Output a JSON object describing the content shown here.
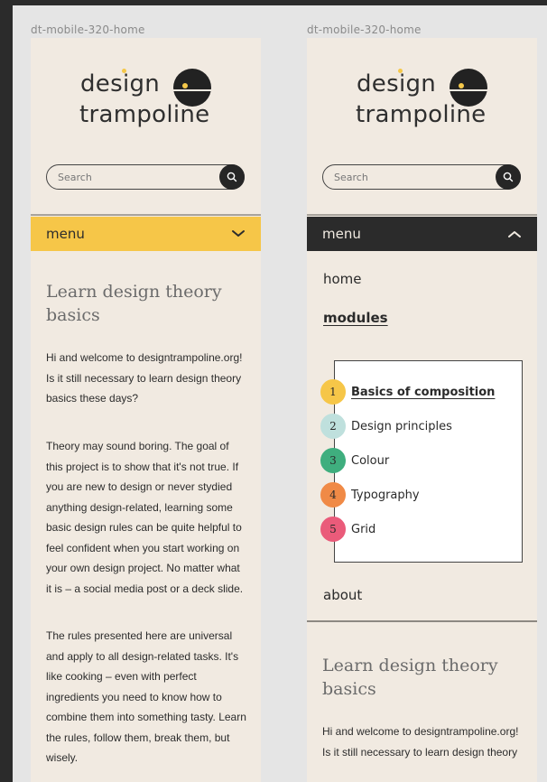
{
  "frames": [
    {
      "label": "dt-mobile-320-home",
      "logo": {
        "line1": "design",
        "line2": "trampoline"
      },
      "search": {
        "placeholder": "Search"
      },
      "menu": {
        "label": "menu",
        "state": "collapsed",
        "accent": "#f6c648"
      },
      "content": {
        "heading": "Learn design theory basics",
        "paragraphs": [
          "Hi and welcome to designtrampoline.org! Is it still necessary to learn design theory basics these days?",
          "Theory may sound boring. The goal of this project is to show that it's not true. If you are new to design or never stydied anything design-related, learning some basic design rules can be quite helpful to feel confident when you start working on your own design project. No matter what it is – a social media post or a deck slide.",
          "The rules presented here are universal and apply to all design-related tasks. It's like cooking – even with perfect ingredients you need to know how to combine them into something tasty. Learn the rules, follow them, break them, but wisely."
        ]
      }
    },
    {
      "label": "dt-mobile-320-home",
      "logo": {
        "line1": "design",
        "line2": "trampoline"
      },
      "search": {
        "placeholder": "Search"
      },
      "menu": {
        "label": "menu",
        "state": "expanded",
        "accent": "#2b2b2b"
      },
      "nav": {
        "home": "home",
        "modules": "modules",
        "about": "about"
      },
      "modules": [
        {
          "num": "1",
          "label": "Basics of composition",
          "color": "#f6c648",
          "active": true
        },
        {
          "num": "2",
          "label": "Design principles",
          "color": "#bfe0dd",
          "active": false
        },
        {
          "num": "3",
          "label": "Colour",
          "color": "#3fae7e",
          "active": false
        },
        {
          "num": "4",
          "label": "Typography",
          "color": "#f08a46",
          "active": false
        },
        {
          "num": "5",
          "label": "Grid",
          "color": "#ea5b7a",
          "active": false
        }
      ],
      "content": {
        "heading": "Learn design theory basics",
        "paragraph": "Hi and welcome to designtrampoline.org! Is it still necessary to learn design theory"
      }
    }
  ]
}
